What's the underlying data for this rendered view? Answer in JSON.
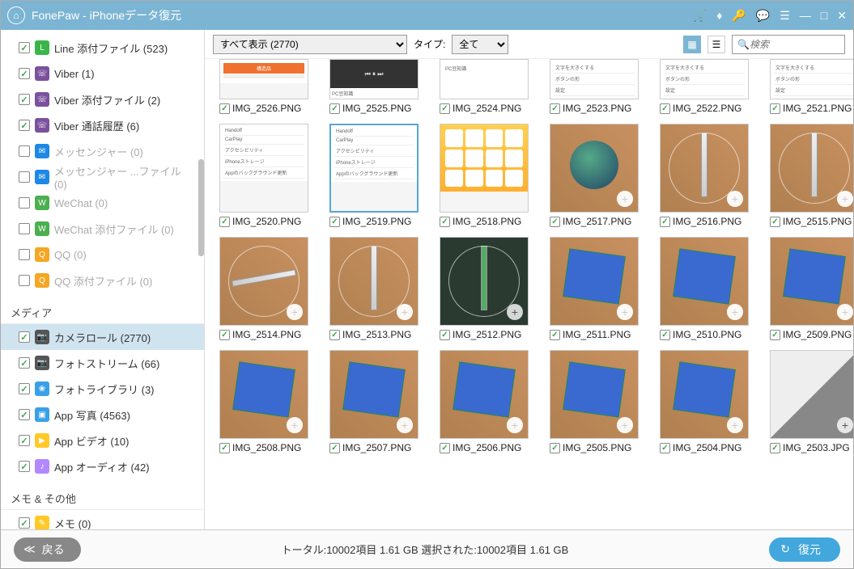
{
  "app_title": "FonePaw - iPhoneデータ復元",
  "sidebar": {
    "items": [
      {
        "checked": true,
        "enabled": true,
        "icon_bg": "#3ab54a",
        "icon_char": "L",
        "label": "Line 添付ファイル (523)"
      },
      {
        "checked": true,
        "enabled": true,
        "icon_bg": "#7b519d",
        "icon_char": "☏",
        "label": "Viber (1)"
      },
      {
        "checked": true,
        "enabled": true,
        "icon_bg": "#7b519d",
        "icon_char": "☏",
        "label": "Viber 添付ファイル (2)"
      },
      {
        "checked": true,
        "enabled": true,
        "icon_bg": "#7b519d",
        "icon_char": "☏",
        "label": "Viber 通話履歴 (6)"
      },
      {
        "checked": false,
        "enabled": false,
        "icon_bg": "#1e88e5",
        "icon_char": "✉",
        "label": "メッセンジャー (0)"
      },
      {
        "checked": false,
        "enabled": false,
        "icon_bg": "#1e88e5",
        "icon_char": "✉",
        "label": "メッセンジャー ...ファイル (0)"
      },
      {
        "checked": false,
        "enabled": false,
        "icon_bg": "#4caf50",
        "icon_char": "W",
        "label": "WeChat (0)"
      },
      {
        "checked": false,
        "enabled": false,
        "icon_bg": "#4caf50",
        "icon_char": "W",
        "label": "WeChat 添付ファイル (0)"
      },
      {
        "checked": false,
        "enabled": false,
        "icon_bg": "#f5a623",
        "icon_char": "Q",
        "label": "QQ (0)"
      },
      {
        "checked": false,
        "enabled": false,
        "icon_bg": "#f5a623",
        "icon_char": "Q",
        "label": "QQ 添付ファイル (0)"
      }
    ],
    "section_media": "メディア",
    "media_items": [
      {
        "checked": true,
        "enabled": true,
        "selected": true,
        "icon_bg": "#555",
        "icon_char": "📷",
        "label": "カメラロール (2770)"
      },
      {
        "checked": true,
        "enabled": true,
        "icon_bg": "#555",
        "icon_char": "📷",
        "label": "フォトストリーム (66)"
      },
      {
        "checked": true,
        "enabled": true,
        "icon_bg": "#3aa0e8",
        "icon_char": "❀",
        "label": "フォトライブラリ (3)"
      },
      {
        "checked": true,
        "enabled": true,
        "icon_bg": "#3aa0e8",
        "icon_char": "▣",
        "label": "App 写真 (4563)"
      },
      {
        "checked": true,
        "enabled": true,
        "icon_bg": "#ffca28",
        "icon_char": "▶",
        "label": "App ビデオ (10)"
      },
      {
        "checked": true,
        "enabled": true,
        "icon_bg": "#b388ff",
        "icon_char": "♪",
        "label": "App オーディオ (42)"
      }
    ],
    "section_memo": "メモ & その他",
    "memo_items": [
      {
        "checked": true,
        "enabled": true,
        "icon_bg": "#ffca28",
        "icon_char": "✎",
        "label": "メモ (0)"
      }
    ]
  },
  "toolbar": {
    "filter_value": "すべて表示 (2770)",
    "type_label": "タイプ:",
    "type_value": "全て",
    "search_placeholder": "検索"
  },
  "thumbs": [
    [
      {
        "name": "IMG_2526.PNG",
        "style": "white-partial",
        "partial": true
      },
      {
        "name": "IMG_2525.PNG",
        "style": "player",
        "partial": true
      },
      {
        "name": "IMG_2524.PNG",
        "style": "pc-tip",
        "partial": true
      },
      {
        "name": "IMG_2523.PNG",
        "style": "settings",
        "partial": true
      },
      {
        "name": "IMG_2522.PNG",
        "style": "settings",
        "partial": true
      },
      {
        "name": "IMG_2521.PNG",
        "style": "settings",
        "partial": true
      }
    ],
    [
      {
        "name": "IMG_2520.PNG",
        "style": "settings-full"
      },
      {
        "name": "IMG_2519.PNG",
        "style": "settings-full",
        "selected": true
      },
      {
        "name": "IMG_2518.PNG",
        "style": "homescreen"
      },
      {
        "name": "IMG_2517.PNG",
        "style": "sphere"
      },
      {
        "name": "IMG_2516.PNG",
        "style": "ruler-wood"
      },
      {
        "name": "IMG_2515.PNG",
        "style": "ruler-wood"
      }
    ],
    [
      {
        "name": "IMG_2514.PNG",
        "style": "ruler-wood-h"
      },
      {
        "name": "IMG_2513.PNG",
        "style": "ruler-wood"
      },
      {
        "name": "IMG_2512.PNG",
        "style": "ruler-dark"
      },
      {
        "name": "IMG_2511.PNG",
        "style": "cloth"
      },
      {
        "name": "IMG_2510.PNG",
        "style": "cloth"
      },
      {
        "name": "IMG_2509.PNG",
        "style": "cloth"
      }
    ],
    [
      {
        "name": "IMG_2508.PNG",
        "style": "cloth"
      },
      {
        "name": "IMG_2507.PNG",
        "style": "cloth"
      },
      {
        "name": "IMG_2506.PNG",
        "style": "cloth"
      },
      {
        "name": "IMG_2505.PNG",
        "style": "cloth"
      },
      {
        "name": "IMG_2504.PNG",
        "style": "cloth"
      },
      {
        "name": "IMG_2503.JPG",
        "style": "corner"
      }
    ]
  ],
  "footer": {
    "back_label": "戻る",
    "status": "トータル:10002項目 1.61 GB   選択された:10002項目 1.61 GB",
    "recover_label": "復元"
  }
}
